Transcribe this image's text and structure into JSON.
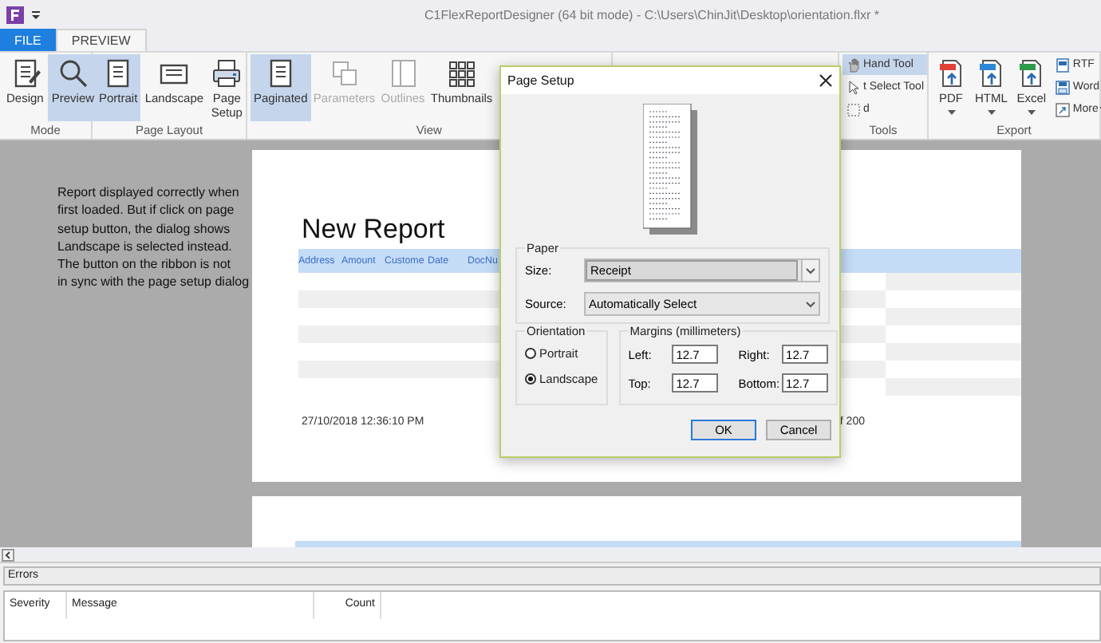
{
  "window": {
    "title": "C1FlexReportDesigner (64 bit mode) - C:\\Users\\ChinJit\\Desktop\\orientation.flxr *"
  },
  "ribbon_tabs": [
    {
      "label": "FILE",
      "kind": "file",
      "selected": false
    },
    {
      "label": "PREVIEW",
      "kind": "tab",
      "selected": true
    }
  ],
  "ribbon_groups": [
    {
      "label": "Mode",
      "buttons": [
        {
          "label": "Design",
          "kind": "large",
          "selected": false,
          "disabled": false,
          "dropdown": false
        },
        {
          "label": "Preview",
          "kind": "large",
          "selected": true,
          "disabled": false,
          "dropdown": false
        }
      ]
    },
    {
      "label": "Page Layout",
      "buttons": [
        {
          "label": "Portrait",
          "kind": "large",
          "selected": true,
          "disabled": false,
          "dropdown": false
        },
        {
          "label": "Landscape",
          "kind": "large",
          "selected": false,
          "disabled": false,
          "dropdown": false
        },
        {
          "label": "Page Setup",
          "kind": "large",
          "selected": false,
          "disabled": false,
          "dropdown": false
        }
      ]
    },
    {
      "label": "View",
      "buttons": [
        {
          "label": "Paginated",
          "kind": "large",
          "selected": true,
          "disabled": false,
          "dropdown": false
        },
        {
          "label": "Parameters",
          "kind": "large",
          "selected": false,
          "disabled": true,
          "dropdown": false
        },
        {
          "label": "Outlines",
          "kind": "large",
          "selected": false,
          "disabled": true,
          "dropdown": false
        },
        {
          "label": "Thumbnails",
          "kind": "large",
          "selected": false,
          "disabled": false,
          "dropdown": false
        }
      ]
    },
    {
      "label": "Tools",
      "buttons": [
        {
          "label": "Hand Tool",
          "kind": "small",
          "selected": true,
          "disabled": false,
          "dropdown": false
        },
        {
          "label": "t Select Tool",
          "kind": "small",
          "selected": false,
          "disabled": false,
          "dropdown": false
        },
        {
          "label": "d",
          "kind": "small",
          "selected": false,
          "disabled": false,
          "dropdown": false
        }
      ]
    },
    {
      "label": "Export",
      "buttons": [
        {
          "label": "PDF",
          "kind": "large",
          "selected": false,
          "disabled": false,
          "dropdown": true
        },
        {
          "label": "HTML",
          "kind": "large",
          "selected": false,
          "disabled": false,
          "dropdown": true
        },
        {
          "label": "Excel",
          "kind": "large",
          "selected": false,
          "disabled": false,
          "dropdown": true
        },
        {
          "label": "RTF",
          "kind": "small",
          "selected": false,
          "disabled": false,
          "dropdown": false
        },
        {
          "label": "Word",
          "kind": "small",
          "selected": false,
          "disabled": false,
          "dropdown": false
        },
        {
          "label": "More",
          "kind": "small",
          "selected": false,
          "disabled": false,
          "dropdown": true
        }
      ]
    }
  ],
  "note": {
    "text": "Report displayed correctly when\nfirst loaded. But if click on page\nsetup button, the dialog shows\nLandscape is selected instead.\nThe button on the ribbon is not\nin sync with the page setup dialog"
  },
  "report": {
    "title": "New Report",
    "columns": [
      "Address",
      "Amount",
      "Custome",
      "Date",
      "DocNu"
    ],
    "footer_left": "27/10/2018 12:36:10 PM",
    "footer_right": "f 200"
  },
  "dialog": {
    "title": "Page Setup",
    "paper": {
      "label": "Paper",
      "fields": [
        {
          "label": "Size:",
          "value": "Receipt",
          "kind": "editable"
        },
        {
          "label": "Source:",
          "value": "Automatically Select",
          "kind": "list"
        }
      ]
    },
    "orientation": {
      "label": "Orientation",
      "options": [
        {
          "label": "Portrait",
          "selected": false
        },
        {
          "label": "Landscape",
          "selected": true
        }
      ]
    },
    "margins": {
      "label": "Margins (millimeters)",
      "fields": [
        {
          "label": "Left:",
          "value": "12.7"
        },
        {
          "label": "Right:",
          "value": "12.7"
        },
        {
          "label": "Top:",
          "value": "12.7"
        },
        {
          "label": "Bottom:",
          "value": "12.7"
        }
      ]
    },
    "buttons": [
      {
        "label": "OK",
        "default": true
      },
      {
        "label": "Cancel",
        "default": false
      }
    ]
  },
  "errors": {
    "title": "Errors",
    "columns": [
      "Severity",
      "Message",
      "Count"
    ]
  }
}
